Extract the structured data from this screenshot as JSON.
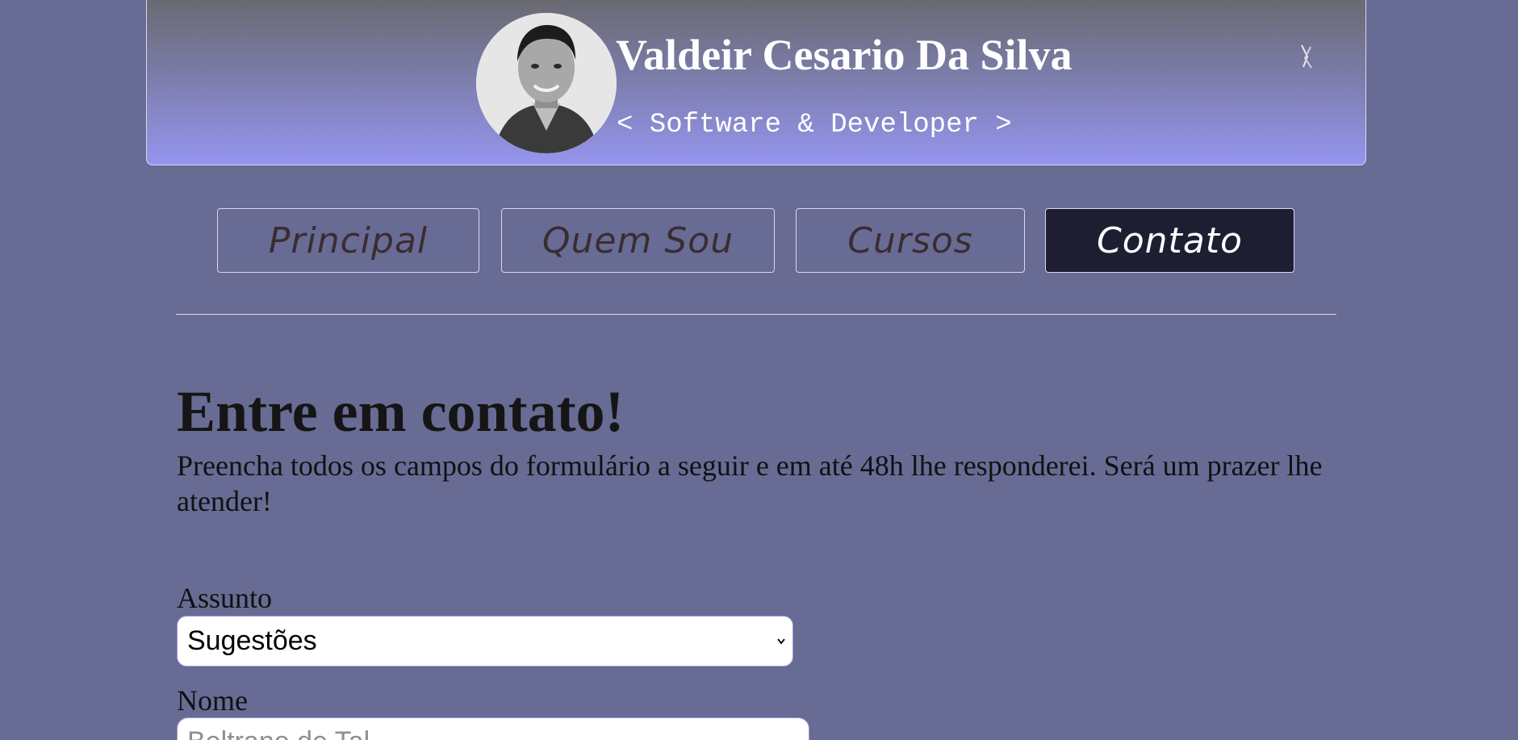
{
  "header": {
    "title": "Valdeir Cesario Da Silva",
    "subtitle": "< Software & Developer >",
    "avatar_icon": "profile-photo",
    "loader_icon": "spinner-icon"
  },
  "nav": {
    "items": [
      {
        "label": "Principal",
        "active": false
      },
      {
        "label": "Quem Sou",
        "active": false
      },
      {
        "label": "Cursos",
        "active": false
      },
      {
        "label": "Contato",
        "active": true
      }
    ]
  },
  "main": {
    "heading": "Entre em contato!",
    "intro": "Preencha todos os campos do formulário a seguir e em até 48h lhe responderei. Será um prazer lhe atender!"
  },
  "form": {
    "subject_label": "Assunto",
    "subject_selected": "Sugestões",
    "name_label": "Nome",
    "name_placeholder": "Beltrano de Tal"
  },
  "colors": {
    "page_background": "#686c94",
    "header_gradient_top": "#6a6a72",
    "header_gradient_bottom": "#9595ee",
    "active_nav": "#1e1e33",
    "nav_text": "#3b2c32"
  }
}
